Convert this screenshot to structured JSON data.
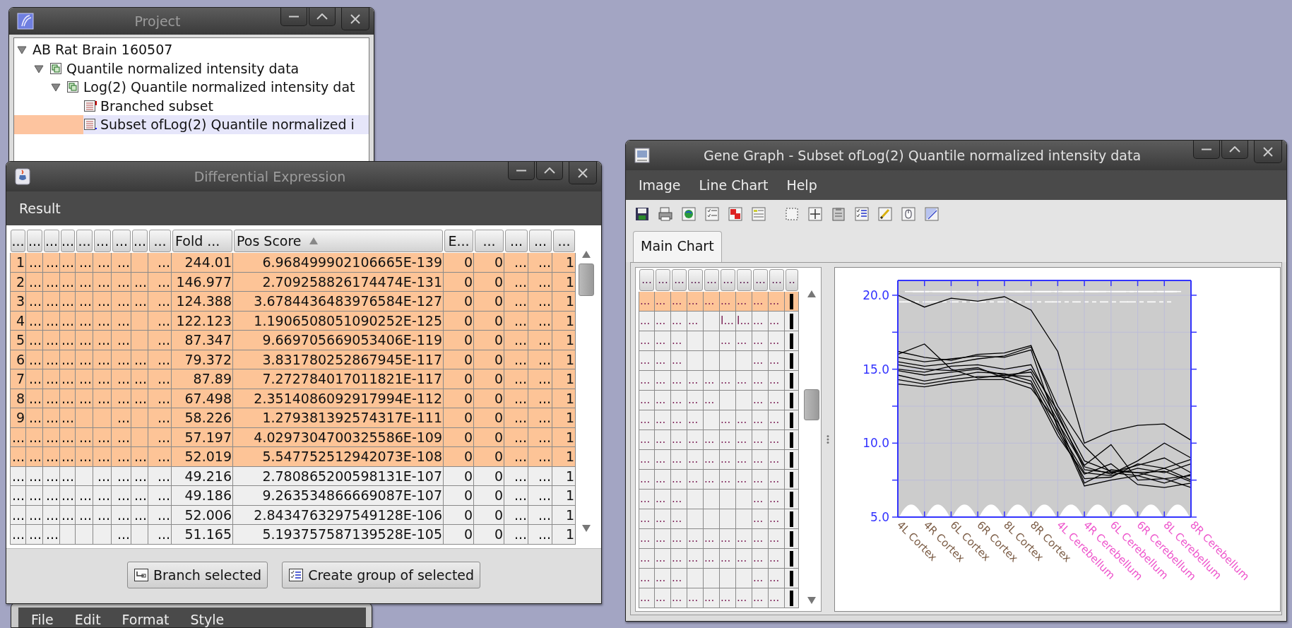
{
  "project_window": {
    "title": "Project",
    "active": false,
    "tree": [
      {
        "label": "AB Rat Brain 160507",
        "expanded": true,
        "selected": false,
        "children": [
          {
            "label": "Quantile normalized intensity data",
            "kind": "dataset",
            "expanded": true,
            "selected": false,
            "children": [
              {
                "label": "Log(2) Quantile normalized intensity dat",
                "kind": "dataset",
                "expanded": true,
                "selected": false,
                "children": [
                  {
                    "label": "Branched subset",
                    "kind": "branched",
                    "selected": false
                  },
                  {
                    "label": "Subset ofLog(2) Quantile normalized i",
                    "kind": "subset",
                    "selected": true
                  }
                ]
              }
            ]
          }
        ]
      }
    ]
  },
  "back_window": {
    "menu": [
      "File",
      "Edit",
      "Format",
      "Style"
    ]
  },
  "de_window": {
    "title": "Differential Expression",
    "active": false,
    "menu": [
      "Result"
    ],
    "table": {
      "columns": [
        {
          "label": "...",
          "sorted": false
        },
        {
          "label": "...",
          "sorted": false
        },
        {
          "label": "...",
          "sorted": false
        },
        {
          "label": "...",
          "sorted": false
        },
        {
          "label": "...",
          "sorted": false
        },
        {
          "label": "...",
          "sorted": false
        },
        {
          "label": "...",
          "sorted": false
        },
        {
          "label": "...",
          "sorted": false
        },
        {
          "label": "...",
          "sorted": false
        },
        {
          "label": "Fold ...",
          "sorted": false
        },
        {
          "label": "Pos Score",
          "sorted": true
        },
        {
          "label": "E...",
          "sorted": false
        },
        {
          "label": "...",
          "sorted": false
        },
        {
          "label": "...",
          "sorted": false
        },
        {
          "label": "...",
          "sorted": false
        },
        {
          "label": "...",
          "sorted": false
        }
      ],
      "rows": [
        {
          "selected": true,
          "cells": [
            "1",
            "...",
            "...",
            "...",
            "...",
            "...",
            "...",
            "",
            "...",
            "244.01",
            "6.968499902106665E-139",
            "0",
            "0",
            "...",
            "...",
            "1"
          ]
        },
        {
          "selected": true,
          "cells": [
            "2",
            "...",
            "...",
            "...",
            "...",
            "...",
            "...",
            "...",
            "...",
            "146.977",
            "2.709258826174474E-131",
            "0",
            "0",
            "...",
            "...",
            "1"
          ]
        },
        {
          "selected": true,
          "cells": [
            "3",
            "...",
            "...",
            "...",
            "...",
            "...",
            "...",
            "...",
            "...",
            "124.388",
            "3.6784436483976584E-127",
            "0",
            "0",
            "...",
            "...",
            "1"
          ]
        },
        {
          "selected": true,
          "cells": [
            "4",
            "...",
            "...",
            "...",
            "...",
            "...",
            "...",
            "",
            "...",
            "122.123",
            "1.1906508051090252E-125",
            "0",
            "0",
            "...",
            "...",
            "1"
          ]
        },
        {
          "selected": true,
          "cells": [
            "5",
            "...",
            "...",
            "...",
            "...",
            "...",
            "...",
            "",
            "...",
            "87.347",
            "9.669705669053406E-119",
            "0",
            "0",
            "...",
            "...",
            "1"
          ]
        },
        {
          "selected": true,
          "cells": [
            "6",
            "...",
            "...",
            "...",
            "...",
            "...",
            "...",
            "...",
            "...",
            "79.372",
            "3.831780252867945E-117",
            "0",
            "0",
            "...",
            "...",
            "1"
          ]
        },
        {
          "selected": true,
          "cells": [
            "7",
            "...",
            "...",
            "...",
            "...",
            "...",
            "...",
            "...",
            "...",
            "87.89",
            "7.272784017011821E-117",
            "0",
            "0",
            "...",
            "...",
            "1"
          ]
        },
        {
          "selected": true,
          "cells": [
            "8",
            "...",
            "...",
            "...",
            "...",
            "...",
            "...",
            "...",
            "...",
            "67.498",
            "2.3514086092917994E-112",
            "0",
            "0",
            "...",
            "...",
            "1"
          ]
        },
        {
          "selected": true,
          "cells": [
            "9",
            "...",
            "...",
            "...",
            "",
            "",
            "...",
            "",
            "...",
            "58.226",
            "1.279381392574317E-111",
            "0",
            "0",
            "...",
            "...",
            "1"
          ]
        },
        {
          "selected": true,
          "cells": [
            "...",
            "...",
            "...",
            "...",
            "...",
            "...",
            "...",
            "",
            "...",
            "57.197",
            "4.0297304700325586E-109",
            "0",
            "0",
            "...",
            "...",
            "1"
          ]
        },
        {
          "selected": true,
          "cells": [
            "...",
            "...",
            "...",
            "...",
            "...",
            "...",
            "...",
            "...",
            "...",
            "52.019",
            "5.547752512942073E-108",
            "0",
            "0",
            "...",
            "...",
            "1"
          ]
        },
        {
          "selected": false,
          "cells": [
            "...",
            "...",
            "...",
            "...",
            "",
            "...",
            "...",
            "...",
            "...",
            "49.216",
            "2.780865200598131E-107",
            "0",
            "0",
            "...",
            "...",
            "1"
          ]
        },
        {
          "selected": false,
          "cells": [
            "...",
            "...",
            "...",
            "...",
            "...",
            "...",
            "...",
            "...",
            "...",
            "49.186",
            "9.263534866669087E-107",
            "0",
            "0",
            "...",
            "...",
            "1"
          ]
        },
        {
          "selected": false,
          "cells": [
            "...",
            "...",
            "...",
            "...",
            "...",
            "...",
            "...",
            "...",
            "...",
            "52.006",
            "2.8434763297549128E-106",
            "0",
            "0",
            "...",
            "...",
            "1"
          ]
        },
        {
          "selected": false,
          "cells": [
            "...",
            "...",
            "...",
            "",
            "",
            "",
            "...",
            "",
            "...",
            "51.165",
            "5.193757587139528E-105",
            "0",
            "0",
            "...",
            "...",
            "1"
          ]
        }
      ]
    },
    "buttons": [
      {
        "label": "Branch selected",
        "kind": "branch"
      },
      {
        "label": "Create group of selected",
        "kind": "group"
      }
    ]
  },
  "gene_window": {
    "title": "Gene Graph - Subset ofLog(2) Quantile normalized intensity data",
    "active": true,
    "menu": [
      "Image",
      "Line Chart",
      "Help"
    ],
    "tabs": [
      {
        "label": "Main Chart",
        "selected": true
      }
    ],
    "table": {
      "columns": [
        "...",
        "...",
        "...",
        "...",
        "...",
        "...",
        "...",
        "...",
        "...",
        ".."
      ],
      "rows": [
        {
          "selected": true,
          "color": "#000000",
          "cells": [
            "...",
            "...",
            "...",
            "...",
            "...",
            "...",
            "...",
            "...",
            "..."
          ]
        },
        {
          "selected": false,
          "color": "#000000",
          "cells": [
            "...",
            "...",
            "...",
            "...",
            "",
            "I...",
            "I...",
            "...",
            "..."
          ]
        },
        {
          "selected": false,
          "color": "#000000",
          "cells": [
            "...",
            "...",
            "...",
            "",
            "",
            "...",
            "...",
            "...",
            "..."
          ]
        },
        {
          "selected": false,
          "color": "#000000",
          "cells": [
            "...",
            "...",
            "...",
            "",
            "",
            "",
            "",
            "...",
            "..."
          ]
        },
        {
          "selected": false,
          "color": "#000000",
          "cells": [
            "...",
            "...",
            "...",
            "...",
            "...",
            "...",
            "...",
            "...",
            "..."
          ]
        },
        {
          "selected": false,
          "color": "#000000",
          "cells": [
            "...",
            "...",
            "...",
            "...",
            "...",
            "",
            "",
            "...",
            "..."
          ]
        },
        {
          "selected": false,
          "color": "#000000",
          "cells": [
            "...",
            "...",
            "...",
            "...",
            "",
            "...",
            "...",
            "...",
            "..."
          ]
        },
        {
          "selected": false,
          "color": "#000000",
          "cells": [
            "...",
            "...",
            "...",
            "...",
            "...",
            "...",
            "...",
            "...",
            "..."
          ]
        },
        {
          "selected": false,
          "color": "#000000",
          "cells": [
            "...",
            "...",
            "...",
            "...",
            "...",
            "...",
            "...",
            "...",
            "..."
          ]
        },
        {
          "selected": false,
          "color": "#000000",
          "cells": [
            "...",
            "...",
            "...",
            "...",
            "...",
            "...",
            "...",
            "...",
            "..."
          ]
        },
        {
          "selected": false,
          "color": "#000000",
          "cells": [
            "...",
            "...",
            "...",
            "",
            "",
            "",
            "",
            "...",
            "..."
          ]
        },
        {
          "selected": false,
          "color": "#000000",
          "cells": [
            "...",
            "...",
            "...",
            "",
            "",
            "",
            "",
            "...",
            "..."
          ]
        },
        {
          "selected": false,
          "color": "#000000",
          "cells": [
            "...",
            "...",
            "...",
            "...",
            "...",
            "...",
            "...",
            "...",
            "..."
          ]
        },
        {
          "selected": false,
          "color": "#000000",
          "cells": [
            "...",
            "...",
            "...",
            "...",
            "...",
            "...",
            "...",
            "...",
            "..."
          ]
        },
        {
          "selected": false,
          "color": "#000000",
          "cells": [
            "...",
            "...",
            "...",
            "",
            "",
            "",
            "",
            "...",
            "..."
          ]
        },
        {
          "selected": false,
          "color": "#000000",
          "cells": [
            "...",
            "...",
            "...",
            "...",
            "...",
            "...",
            "...",
            "...",
            "..."
          ]
        }
      ]
    },
    "chart": {
      "x_labels": [
        {
          "color": "#7b5c45"
        },
        {
          "color": "#7b5c45"
        },
        {
          "color": "#7b5c45"
        },
        {
          "color": "#7b5c45"
        },
        {
          "color": "#7b5c45"
        },
        {
          "color": "#7b5c45"
        },
        {
          "color": "#ee55cc"
        },
        {
          "color": "#ee55cc"
        },
        {
          "color": "#ee55cc"
        },
        {
          "color": "#ee55cc"
        },
        {
          "color": "#ee55cc"
        },
        {
          "color": "#ee55cc"
        }
      ],
      "chart_data": {
        "type": "line",
        "grid": true,
        "categories": [
          "4L Cortex",
          "4R Cortex",
          "6L Cortex",
          "6R Cortex",
          "8L Cortex",
          "8R Cortex",
          "4L Cerebellum",
          "4R Cerebellum",
          "6L Cerebellum",
          "6R Cerebellum",
          "8L Cerebellum",
          "8R Cerebellum"
        ],
        "ylim": [
          5,
          21
        ],
        "yticks": [
          {
            "value": 5,
            "label": "5.0"
          },
          {
            "value": 10,
            "label": "10.0"
          },
          {
            "value": 15,
            "label": "15.0"
          },
          {
            "value": 20,
            "label": "20.0"
          }
        ],
        "series": [
          {
            "color": "#000000",
            "values": [
              20.0,
              19.2,
              19.8,
              19.6,
              19.9,
              19.0,
              16.2,
              10.0,
              10.8,
              11.2,
              11.3,
              10.2
            ]
          },
          {
            "color": "#000000",
            "values": [
              16.2,
              15.8,
              15.6,
              16.0,
              16.1,
              16.6,
              12.0,
              8.2,
              8.0,
              7.8,
              8.3,
              7.5
            ]
          },
          {
            "color": "#000000",
            "values": [
              16.0,
              16.7,
              15.0,
              14.4,
              14.6,
              14.8,
              11.5,
              7.3,
              8.2,
              8.0,
              7.6,
              7.0
            ]
          },
          {
            "color": "#000000",
            "values": [
              15.8,
              15.5,
              15.7,
              15.9,
              15.8,
              16.3,
              11.0,
              8.0,
              7.8,
              8.3,
              8.0,
              8.6
            ]
          },
          {
            "color": "#000000",
            "values": [
              15.5,
              15.2,
              15.4,
              15.7,
              15.9,
              16.5,
              12.5,
              9.8,
              8.0,
              8.5,
              9.0,
              8.0
            ]
          },
          {
            "color": "#000000",
            "values": [
              15.0,
              14.8,
              15.2,
              15.3,
              15.0,
              15.3,
              11.8,
              8.5,
              9.9,
              7.5,
              7.6,
              7.8
            ]
          },
          {
            "color": "#000000",
            "values": [
              14.9,
              14.6,
              14.8,
              15.0,
              14.6,
              14.5,
              11.2,
              7.1,
              7.5,
              7.8,
              7.3,
              7.9
            ]
          },
          {
            "color": "#000000",
            "values": [
              14.6,
              14.2,
              14.5,
              14.8,
              14.7,
              14.2,
              10.8,
              7.6,
              7.7,
              8.6,
              8.3,
              8.9
            ]
          },
          {
            "color": "#000000",
            "values": [
              14.3,
              14.0,
              14.3,
              14.5,
              14.5,
              14.0,
              10.5,
              7.9,
              8.6,
              7.2,
              7.0,
              7.3
            ]
          },
          {
            "color": "#000000",
            "values": [
              14.0,
              13.8,
              14.1,
              14.3,
              14.3,
              13.7,
              11.4,
              8.4,
              7.9,
              8.8,
              10.0,
              9.0
            ]
          },
          {
            "color": "#000000",
            "values": [
              15.3,
              15.0,
              14.9,
              15.1,
              14.4,
              15.0,
              12.2,
              8.8,
              8.1,
              8.0,
              8.1,
              7.4
            ]
          }
        ]
      }
    }
  }
}
